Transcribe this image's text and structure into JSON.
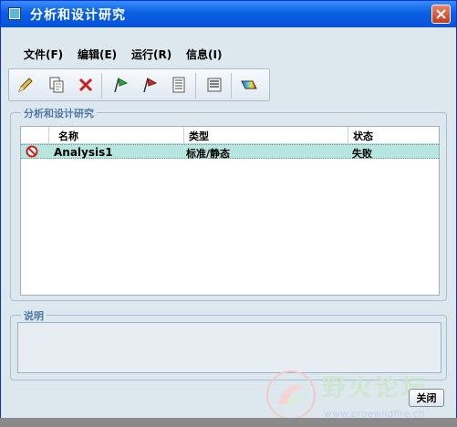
{
  "window": {
    "title": "分析和设计研究",
    "close_icon": "close-icon"
  },
  "menu": [
    {
      "label": "文件(F)"
    },
    {
      "label": "编辑(E)"
    },
    {
      "label": "运行(R)"
    },
    {
      "label": "信息(I)"
    }
  ],
  "toolbar": {
    "icons": [
      "pencil-icon",
      "copy-icon",
      "delete-icon",
      "green-flag-icon",
      "red-flag-icon",
      "list-icon",
      "info-icon",
      "results-icon"
    ]
  },
  "studies_group": {
    "label": "分析和设计研究",
    "columns": [
      "名称",
      "类型",
      "状态"
    ],
    "rows": [
      {
        "status_icon": "error-icon",
        "name": "Analysis1",
        "type": "标准/静态",
        "status": "失败"
      }
    ]
  },
  "description_group": {
    "label": "说明",
    "text": ""
  },
  "buttons": {
    "close_label": "关闭"
  },
  "watermark": {
    "text_cn": "野火论坛",
    "text_en": "www.proewildfire.cn"
  },
  "colors": {
    "titlebar": "#0553d8",
    "selected_row": "#b7e6de",
    "group_label": "#4f7aa6"
  }
}
